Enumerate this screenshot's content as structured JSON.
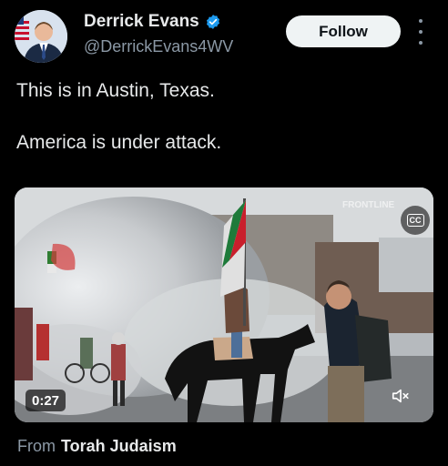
{
  "author": {
    "display_name": "Derrick Evans",
    "handle": "@DerrickEvans4WV",
    "verified": true
  },
  "follow_label": "Follow",
  "tweet": {
    "lines": [
      "This is in Austin, Texas.",
      "America is under attack."
    ]
  },
  "media": {
    "duration": "0:27",
    "captions_label": "CC",
    "muted": true
  },
  "attribution": {
    "prefix": "From",
    "source": "Torah Judaism"
  },
  "colors": {
    "background": "#000000",
    "text_primary": "#e7e9ea",
    "text_secondary": "#8b98a5",
    "verified_blue": "#1d9bf0",
    "follow_button": "#eff3f4"
  },
  "icons": [
    "verified-badge-icon",
    "more-options-icon",
    "closed-captions-icon",
    "mute-icon"
  ]
}
